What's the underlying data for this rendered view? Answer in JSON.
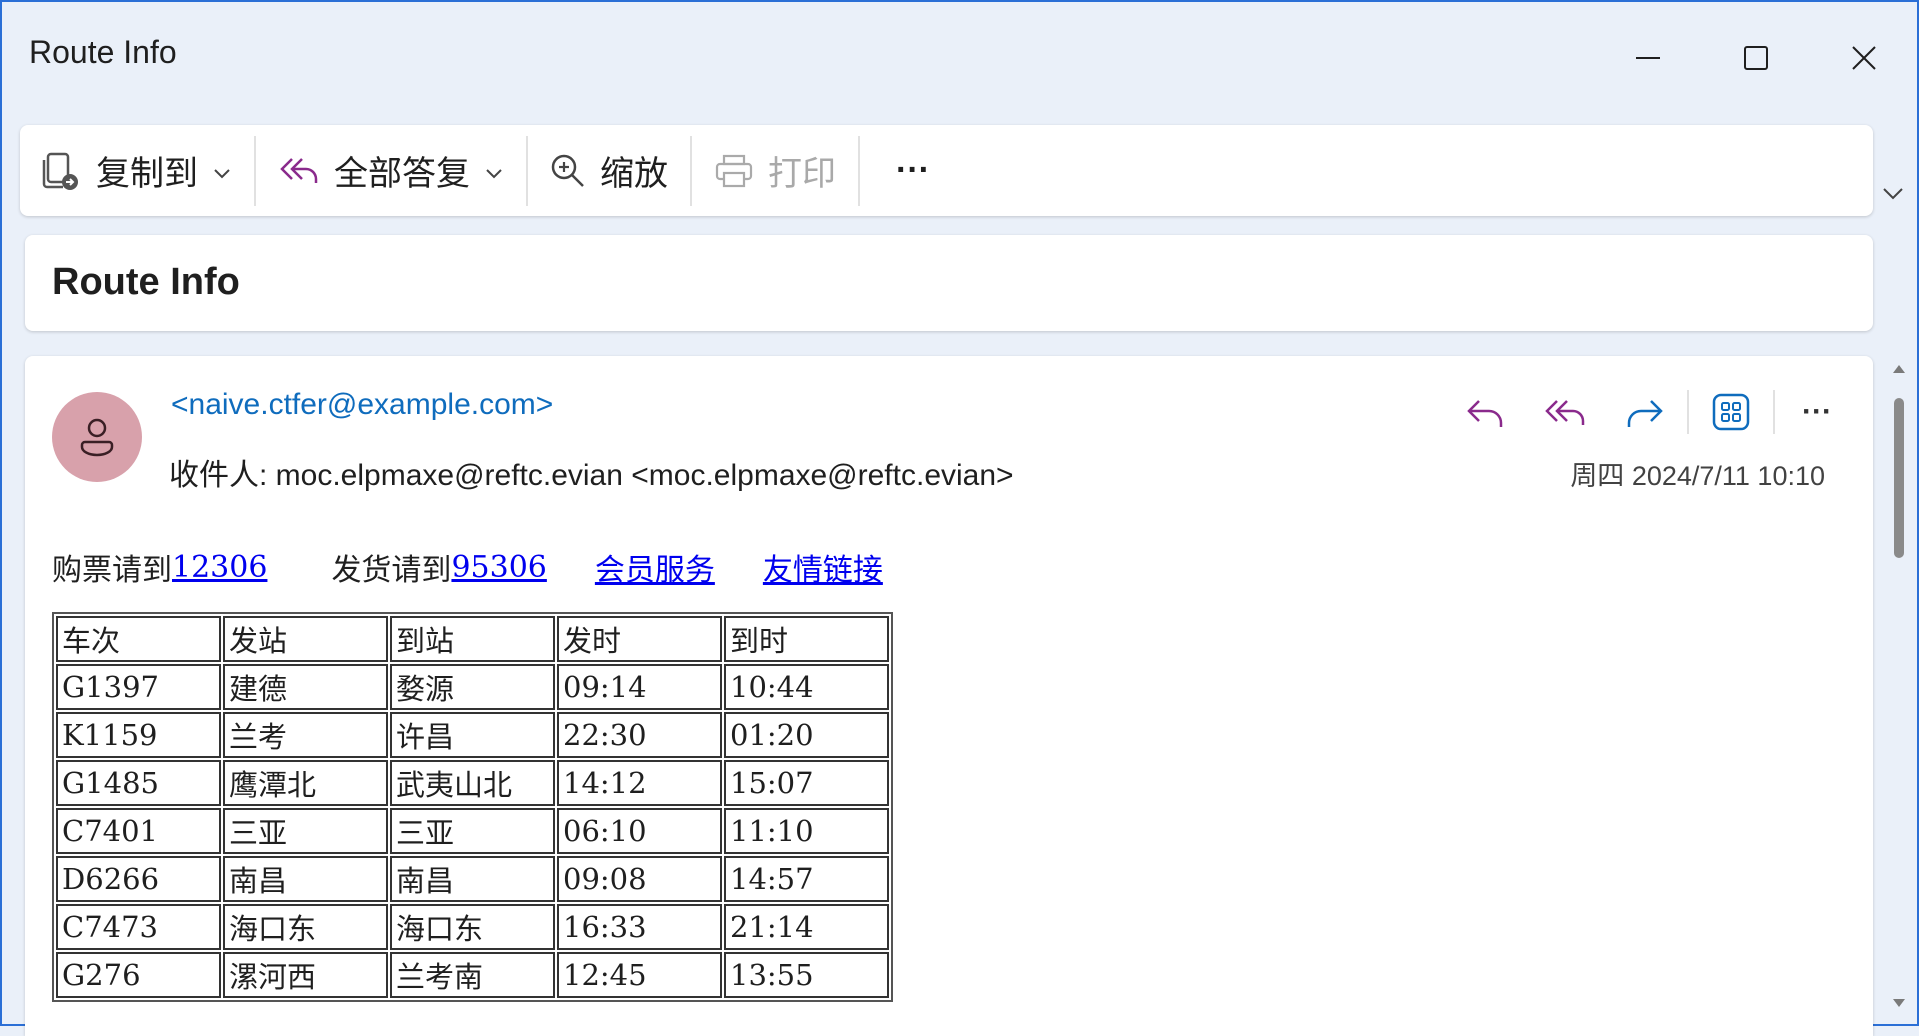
{
  "window": {
    "title": "Route Info"
  },
  "ribbon": {
    "copy_to": "复制到",
    "reply_all": "全部答复",
    "zoom": "缩放",
    "print": "打印",
    "more": "···"
  },
  "message": {
    "subject": "Route Info",
    "sender": "<naive.ctfer@example.com>",
    "recipients": "收件人:  moc.elpmaxe@reftc.evian <moc.elpmaxe@reftc.evian>",
    "datetime": "周四 2024/7/11 10:10",
    "more": "···"
  },
  "body": {
    "buy_prefix": "购票请到",
    "buy_link": "12306",
    "ship_prefix": "发货请到",
    "ship_link": "95306",
    "member_link": "会员服务",
    "friend_link": "友情链接",
    "table": {
      "headers": [
        "车次",
        "发站",
        "到站",
        "发时",
        "到时"
      ],
      "rows": [
        [
          "G1397",
          "建德",
          "婺源",
          "09:14",
          "10:44"
        ],
        [
          "K1159",
          "兰考",
          "许昌",
          "22:30",
          "01:20"
        ],
        [
          "G1485",
          "鹰潭北",
          "武夷山北",
          "14:12",
          "15:07"
        ],
        [
          "C7401",
          "三亚",
          "三亚",
          "06:10",
          "11:10"
        ],
        [
          "D6266",
          "南昌",
          "南昌",
          "09:08",
          "14:57"
        ],
        [
          "C7473",
          "海口东",
          "海口东",
          "16:33",
          "21:14"
        ],
        [
          "G276",
          "漯河西",
          "兰考南",
          "12:45",
          "13:55"
        ]
      ]
    }
  },
  "colors": {
    "accent": "#0f6cbd",
    "reply_icon": "#8a2a8c",
    "avatar_bg": "#d8a1ab",
    "link": "#0000ee"
  }
}
